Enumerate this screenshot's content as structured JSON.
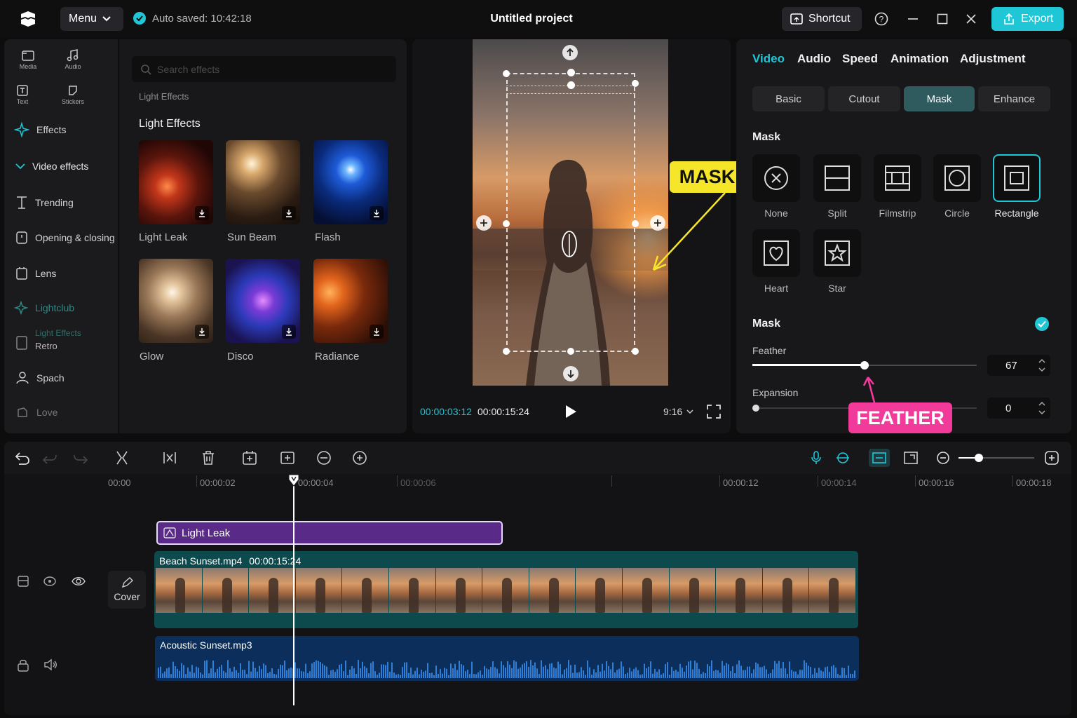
{
  "app": {
    "menu_label": "Menu",
    "autosave": "Auto saved: 10:42:18",
    "title": "Untitled project",
    "shortcut_label": "Shortcut",
    "export_label": "Export",
    "accent": "#1fc6d6"
  },
  "sidebar": {
    "top_icons": [
      "Media",
      "Audio",
      "Text",
      "Stickers"
    ],
    "items": [
      {
        "label": "Effects",
        "icon": "sparkle-icon"
      },
      {
        "label": "Video effects",
        "icon": "chevron-down-icon"
      },
      {
        "label": "Trending",
        "icon": "trending-icon"
      },
      {
        "label": "Opening & closing",
        "icon": "opening-icon"
      },
      {
        "label": "Lens",
        "icon": "lens-icon"
      },
      {
        "label": "Lightclub",
        "icon": "lightclub-icon"
      },
      {
        "label": "Light Effects",
        "icon": "light-effects-icon"
      },
      {
        "label": "Retro",
        "icon": "retro-icon"
      },
      {
        "label": "Spach",
        "icon": "spach-icon"
      },
      {
        "label": "Love",
        "icon": "love-icon"
      }
    ]
  },
  "effects_panel": {
    "search_placeholder": "Search effects",
    "breadcrumb": "Light Effects",
    "section_title": "Light Effects",
    "effects": [
      {
        "label": "Light Leak"
      },
      {
        "label": "Sun Beam"
      },
      {
        "label": "Flash"
      },
      {
        "label": "Glow"
      },
      {
        "label": "Disco"
      },
      {
        "label": "Radiance"
      }
    ]
  },
  "preview": {
    "current_time": "00:00:03:12",
    "total_time": "00:00:15:24",
    "aspect_ratio": "9:16",
    "callout_mask": "MASK"
  },
  "inspector": {
    "tabs": [
      "Video",
      "Audio",
      "Speed",
      "Animation",
      "Adjustment"
    ],
    "active_tab": "Video",
    "subtabs": [
      "Basic",
      "Cutout",
      "Mask",
      "Enhance"
    ],
    "active_subtab": "Mask",
    "mask_heading": "Mask",
    "shapes": [
      "None",
      "Split",
      "Filmstrip",
      "Circle",
      "Rectangle",
      "Heart",
      "Star"
    ],
    "selected_shape": "Rectangle",
    "mask_toggle_heading": "Mask",
    "mask_enabled": true,
    "feather_label": "Feather",
    "feather_value": "67",
    "feather_fraction": 0.5,
    "expansion_label": "Expansion",
    "expansion_value": "0",
    "expansion_fraction": 0.0,
    "callout_feather": "FEATHER"
  },
  "timeline": {
    "ruler": [
      "00:00",
      "00:00:02",
      "00:00:04",
      "00:00:06",
      "00:00:12",
      "00:00:14",
      "00:00:16",
      "00:00:18"
    ],
    "effect_clip": "Light Leak",
    "video_clip_name": "Beach Sunset.mp4",
    "video_clip_duration": "00:00:15:24",
    "audio_clip_name": "Acoustic Sunset.mp3",
    "cover_label": "Cover"
  }
}
